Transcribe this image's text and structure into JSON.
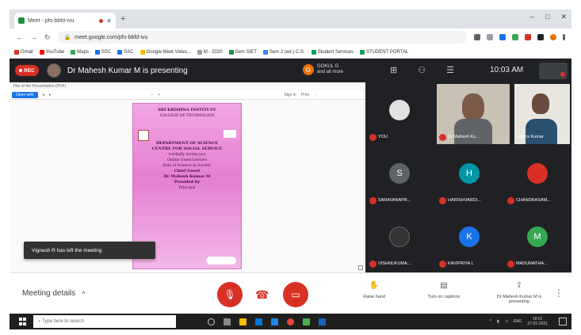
{
  "browser": {
    "tab_title": "Meet - pfs-bbfd-ivu",
    "new_tab": "+",
    "window_controls": [
      "–",
      "□",
      "✕"
    ],
    "url": "meet.google.com/pfs-bbfd-ivu",
    "bookmarks": [
      "Gmail",
      "YouTube",
      "Maps",
      "SSC",
      "SSC",
      "Google Meet Video...",
      "M - 2020",
      "Sem SIET",
      "Sem 2 (ed.) C.S.",
      "Student Services",
      "STUDENT PORTAL"
    ]
  },
  "meet": {
    "rec_label": "REC",
    "presenting_text": "Dr Mahesh Kumar M is presenting",
    "you_chip": {
      "initial": "G",
      "line1": "GOKUL G",
      "line2": "and all more"
    },
    "clock": "10:03 AM",
    "toast": "Vignesh R has left the meeting",
    "participants": [
      {
        "name": "You",
        "kind": "avatar",
        "initial": "",
        "color": "#e0e0e0"
      },
      {
        "name": "Dr Mahesh Ku...",
        "kind": "camera"
      },
      {
        "name": "Maths Kumar",
        "kind": "camera"
      },
      {
        "name": "SARAVANAPR...",
        "kind": "avatar",
        "initial": "S",
        "color": "#5f6368"
      },
      {
        "name": "HARISHVARDI...",
        "kind": "avatar",
        "initial": "H",
        "color": "#0097a7"
      },
      {
        "name": "CHANDRASAM...",
        "kind": "avatar",
        "initial": "",
        "color": "#d93025"
      },
      {
        "name": "VISHNUKUMA...",
        "kind": "avatar",
        "initial": "",
        "color": "#333333"
      },
      {
        "name": "KAVIPRIYA L",
        "kind": "avatar",
        "initial": "K",
        "color": "#1a73e8"
      },
      {
        "name": "MADUMATHA...",
        "kind": "avatar",
        "initial": "M",
        "color": "#34a853"
      }
    ]
  },
  "presentation": {
    "doc_header": "Title of the Presentation (PDF)",
    "toolbar_btn": "Open with",
    "toolbar_items": [
      "◂",
      "▸",
      "−",
      "+",
      "Sign in",
      "Print",
      "⋮"
    ],
    "invite_lines": [
      "SRI KRISHNA INSTITUTE",
      "COLLEGE OF TECHNOLOGY",
      "",
      "DEPARTMENT OF SCIENCE",
      "CENTRE FOR SOCIAL SERVICE",
      "cordially invites you",
      "",
      "Online Guest Lecture",
      "Role of Science in Society",
      "",
      "Chief Guest",
      "Dr Mahesh Kumar M",
      "",
      "Presided by",
      "Principal"
    ]
  },
  "controls": {
    "meeting_details": "Meeting details",
    "chevron": "^",
    "items": [
      {
        "icon": "✋",
        "label": "Raise hand"
      },
      {
        "icon": "▤",
        "label": "Turn on captions"
      },
      {
        "icon": "⇪",
        "label": "Dr Mahesh Kumar M is presenting"
      }
    ],
    "more": "⋮"
  },
  "taskbar": {
    "search_placeholder": "Type here to search",
    "date": "18:01",
    "date2": "27-01-2021",
    "lang": "ENG"
  },
  "colors": {
    "meet_dark": "#202124",
    "red": "#d93025",
    "blue": "#1a73e8"
  }
}
